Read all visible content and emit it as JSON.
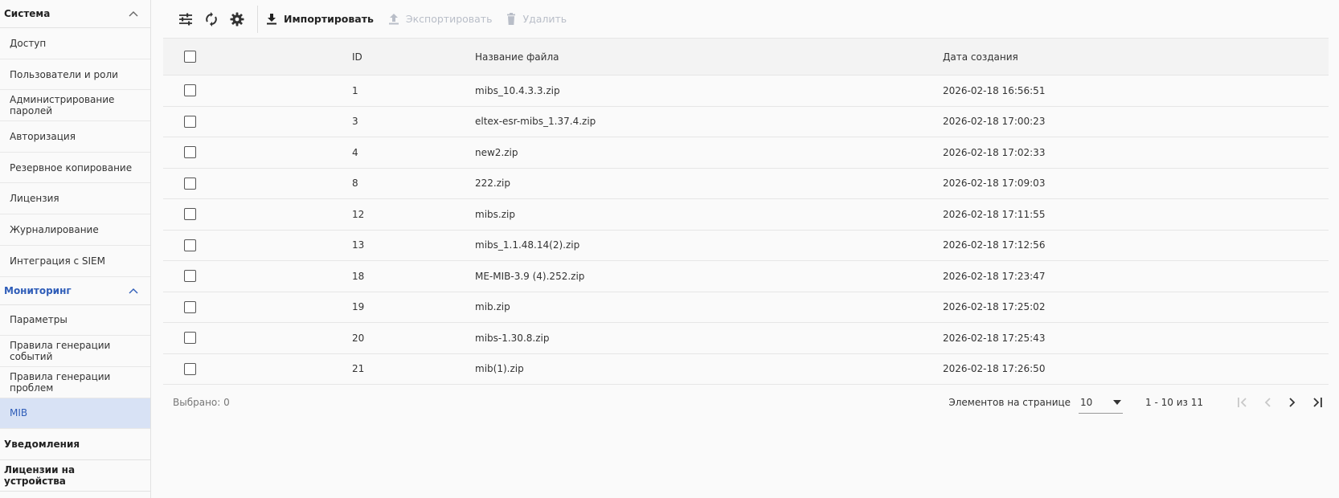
{
  "sidebar": {
    "group_system": "Система",
    "system_items": [
      "Доступ",
      "Пользователи и роли",
      "Администрирование паролей",
      "Авторизация",
      "Резервное копирование",
      "Лицензия",
      "Журналирование",
      "Интеграция с SIEM"
    ],
    "group_monitoring": "Мониторинг",
    "monitoring_items": [
      "Параметры",
      "Правила генерации событий",
      "Правила генерации проблем",
      "MIB"
    ],
    "group_notifications": "Уведомления",
    "group_device_licenses": "Лицензии на устройства"
  },
  "toolbar": {
    "filter_icon": "tune-icon",
    "refresh_icon": "refresh-icon",
    "settings_icon": "gear-icon",
    "import_label": "Импортировать",
    "export_label": "Экспортировать",
    "delete_label": "Удалить"
  },
  "table": {
    "headers": {
      "id": "ID",
      "name": "Название файла",
      "date": "Дата создания"
    },
    "rows": [
      {
        "id": "1",
        "name": "mibs_10.4.3.3.zip",
        "date": "2026-02-18 16:56:51"
      },
      {
        "id": "3",
        "name": "eltex-esr-mibs_1.37.4.zip",
        "date": "2026-02-18 17:00:23"
      },
      {
        "id": "4",
        "name": "new2.zip",
        "date": "2026-02-18 17:02:33"
      },
      {
        "id": "8",
        "name": "222.zip",
        "date": "2026-02-18 17:09:03"
      },
      {
        "id": "12",
        "name": "mibs.zip",
        "date": "2026-02-18 17:11:55"
      },
      {
        "id": "13",
        "name": "mibs_1.1.48.14(2).zip",
        "date": "2026-02-18 17:12:56"
      },
      {
        "id": "18",
        "name": "ME-MIB-3.9 (4).252.zip",
        "date": "2026-02-18 17:23:47"
      },
      {
        "id": "19",
        "name": "mib.zip",
        "date": "2026-02-18 17:25:02"
      },
      {
        "id": "20",
        "name": "mibs-1.30.8.zip",
        "date": "2026-02-18 17:25:43"
      },
      {
        "id": "21",
        "name": "mib(1).zip",
        "date": "2026-02-18 17:26:50"
      }
    ]
  },
  "footer": {
    "selected": "Выбрано: 0",
    "per_page_label": "Элементов на странице",
    "per_page_value": "10",
    "range": "1 - 10 из 11"
  },
  "colors": {
    "accent": "#2f5db8",
    "active_bg": "#d8e2f5"
  }
}
